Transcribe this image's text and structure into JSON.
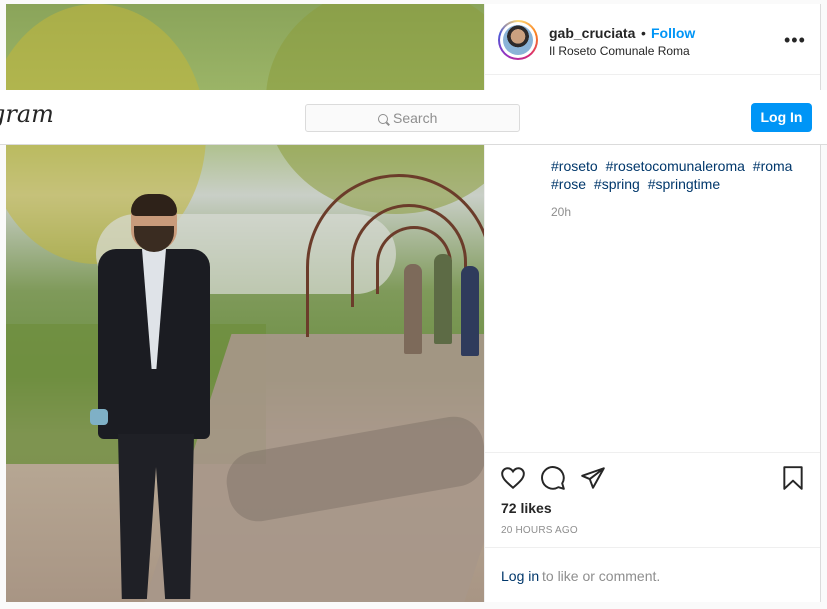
{
  "nav": {
    "logo_text": "gram",
    "search_placeholder": "Search",
    "login_button": "Log In"
  },
  "post": {
    "username": "gab_cruciata",
    "separator": "•",
    "follow_label": "Follow",
    "location": "Il Roseto Comunale Roma",
    "more_label": "•••",
    "hashtags": [
      "#roseto",
      "#rosetocomunaleroma",
      "#roma",
      "#rose",
      "#spring",
      "#springtime"
    ],
    "caption_time": "20h",
    "likes": "72 likes",
    "time_ago": "20 HOURS AGO",
    "comment_prompt": {
      "link": "Log in",
      "rest": "to like or comment."
    }
  },
  "icons": {
    "like": "heart-icon",
    "comment": "comment-bubble-icon",
    "share": "paper-plane-icon",
    "save": "bookmark-icon",
    "search": "search-icon"
  }
}
